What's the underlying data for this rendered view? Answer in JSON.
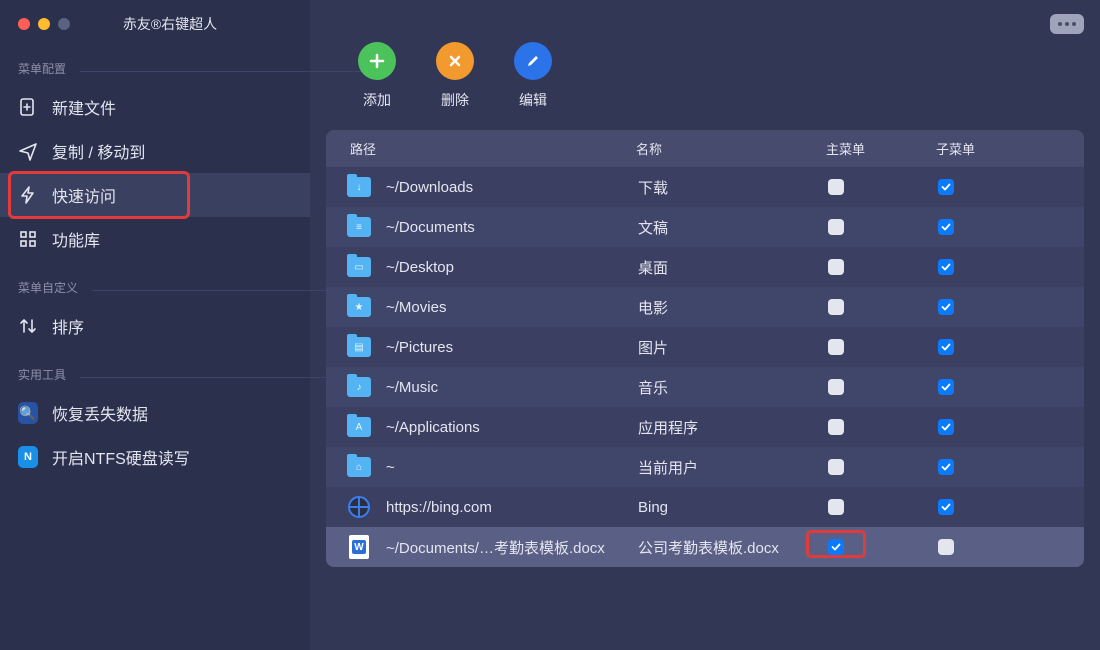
{
  "app_title": "赤友®右键超人",
  "toolbar": {
    "add_label": "添加",
    "delete_label": "删除",
    "edit_label": "编辑"
  },
  "sidebar": {
    "sections": [
      {
        "title": "菜单配置",
        "items": [
          {
            "label": "新建文件",
            "icon": "plus-file",
            "selected": false
          },
          {
            "label": "复制 / 移动到",
            "icon": "send",
            "selected": false
          },
          {
            "label": "快速访问",
            "icon": "bolt",
            "selected": true,
            "highlight": true
          },
          {
            "label": "功能库",
            "icon": "grid",
            "selected": false
          }
        ]
      },
      {
        "title": "菜单自定义",
        "items": [
          {
            "label": "排序",
            "icon": "sort",
            "selected": false
          }
        ]
      },
      {
        "title": "实用工具",
        "items": [
          {
            "label": "恢复丢失数据",
            "icon": "recover",
            "selected": false
          },
          {
            "label": "开启NTFS硬盘读写",
            "icon": "ntfs",
            "selected": false
          }
        ]
      }
    ]
  },
  "table": {
    "headers": {
      "path": "路径",
      "name": "名称",
      "main_menu": "主菜单",
      "sub_menu": "子菜单"
    },
    "rows": [
      {
        "icon": "folder",
        "glyph": "↓",
        "path": "~/Downloads",
        "name": "下载",
        "main": false,
        "sub": true
      },
      {
        "icon": "folder",
        "glyph": "≡",
        "path": "~/Documents",
        "name": "文稿",
        "main": false,
        "sub": true
      },
      {
        "icon": "folder",
        "glyph": "▭",
        "path": "~/Desktop",
        "name": "桌面",
        "main": false,
        "sub": true
      },
      {
        "icon": "folder",
        "glyph": "★",
        "path": "~/Movies",
        "name": "电影",
        "main": false,
        "sub": true
      },
      {
        "icon": "folder",
        "glyph": "▤",
        "path": "~/Pictures",
        "name": "图片",
        "main": false,
        "sub": true
      },
      {
        "icon": "folder",
        "glyph": "♪",
        "path": "~/Music",
        "name": "音乐",
        "main": false,
        "sub": true
      },
      {
        "icon": "folder",
        "glyph": "A",
        "path": "~/Applications",
        "name": "应用程序",
        "main": false,
        "sub": true
      },
      {
        "icon": "folder",
        "glyph": "⌂",
        "path": "~",
        "name": "当前用户",
        "main": false,
        "sub": true
      },
      {
        "icon": "globe",
        "glyph": "",
        "path": "https://bing.com",
        "name": "Bing",
        "main": false,
        "sub": true
      },
      {
        "icon": "doc",
        "glyph": "W",
        "path": "~/Documents/…考勤表模板.docx",
        "name": "公司考勤表模板.docx",
        "main": true,
        "sub": false,
        "selected": true,
        "highlight_main": true
      }
    ]
  }
}
